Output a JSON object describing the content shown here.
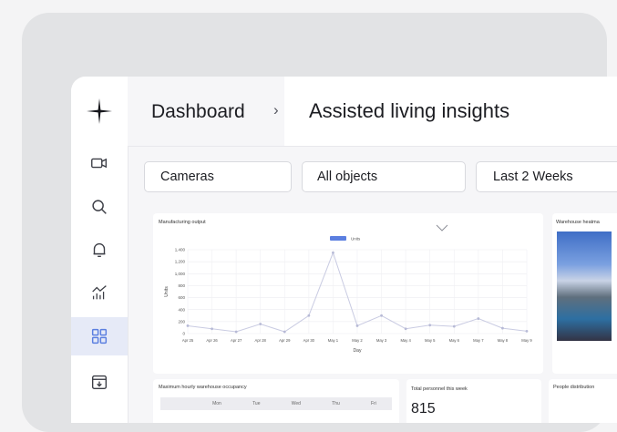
{
  "breadcrumb": {
    "root": "Dashboard",
    "separator": "›",
    "current": "Assisted living insights"
  },
  "filters": {
    "cameras": "Cameras",
    "objects": "All objects",
    "range": "Last 2 Weeks"
  },
  "cards": {
    "manufacturing_title": "Manufacturing output",
    "legend_label": "Units",
    "heatmap_title": "Warehouse heatma",
    "occupancy_title": "Maximum hourly warehouse occupancy",
    "occupancy_days": [
      "Mon",
      "Tue",
      "Wed",
      "Thu",
      "Fri"
    ],
    "personnel_title": "Total personnel this week",
    "personnel_value": "815",
    "people_title": "People distribution"
  },
  "colors": {
    "accent": "#5b7fe0",
    "line": "#c9cbe2",
    "active_nav": "#e6eaf7"
  },
  "icons": {
    "logo": "sparkle-icon",
    "nav": [
      "camera-icon",
      "search-icon",
      "bell-icon",
      "analytics-icon",
      "grid-icon",
      "archive-icon"
    ]
  },
  "chart_data": {
    "type": "line",
    "title": "Manufacturing output",
    "xlabel": "Day",
    "ylabel": "Units",
    "ylim": [
      0,
      1400
    ],
    "yticks": [
      "1,400",
      "1,200",
      "1,000",
      "800",
      "600",
      "400",
      "200",
      "0"
    ],
    "x": [
      "Apr 25",
      "Apr 26",
      "Apr 27",
      "Apr 28",
      "Apr 29",
      "Apr 30",
      "May 1",
      "May 2",
      "May 3",
      "May 4",
      "May 5",
      "May 6",
      "May 7",
      "May 8",
      "May 9"
    ],
    "series": [
      {
        "name": "Units",
        "values": [
          130,
          80,
          30,
          160,
          30,
          300,
          1350,
          130,
          300,
          80,
          140,
          120,
          250,
          90,
          40
        ]
      }
    ],
    "grid": true,
    "legend": "top-center"
  }
}
